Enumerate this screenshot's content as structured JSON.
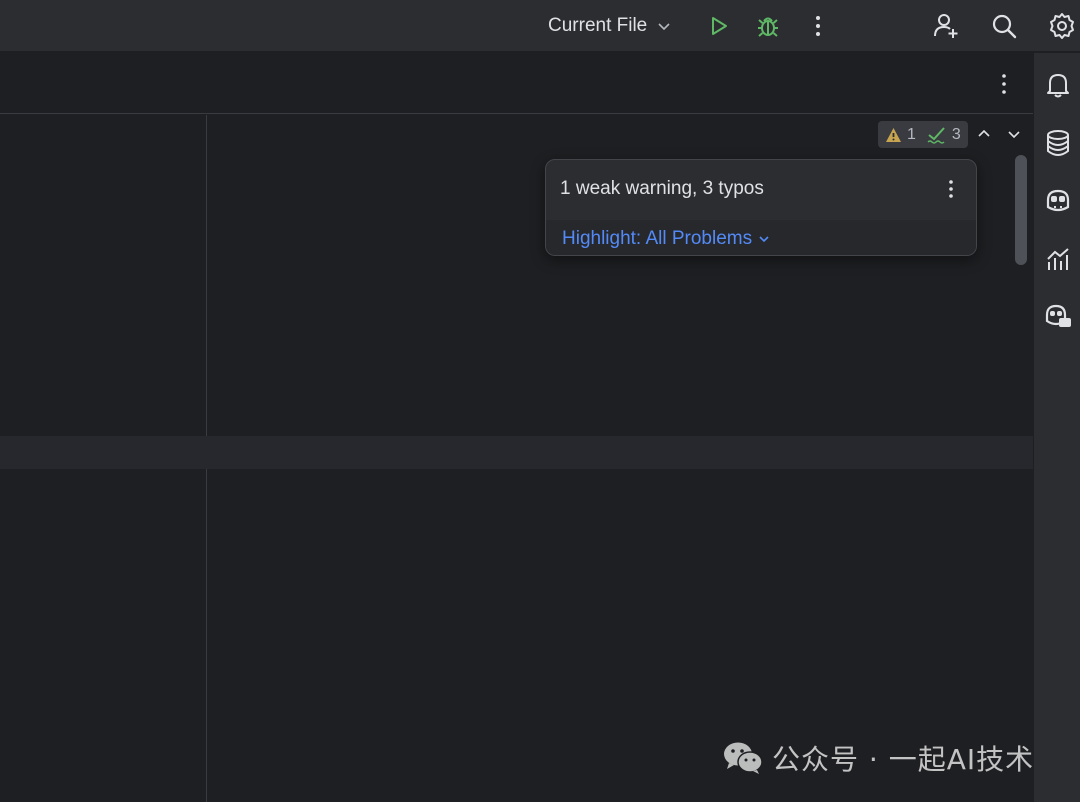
{
  "toolbar": {
    "run_config_label": "Current File",
    "icons": [
      "chevron-down-icon",
      "run-icon",
      "debug-icon",
      "more-vertical-icon",
      "add-user-icon",
      "search-icon",
      "settings-icon"
    ],
    "run_color": "#5fb865",
    "debug_color": "#5fb865"
  },
  "editor": {
    "inspection_widget": {
      "warning_count": "1",
      "typo_count": "3",
      "warning_color": "#c7a450",
      "typo_color": "#5fb865"
    }
  },
  "popup": {
    "title": "1 weak warning, 3 typos",
    "highlight_label": "Highlight: All Problems",
    "link_color": "#548af7"
  },
  "right_bar": {
    "icons": [
      "notifications-icon",
      "database-icon",
      "copilot-icon",
      "profiler-icon",
      "copilot-chat-icon"
    ]
  },
  "watermark": {
    "text": "公众号 · 一起AI技术"
  }
}
